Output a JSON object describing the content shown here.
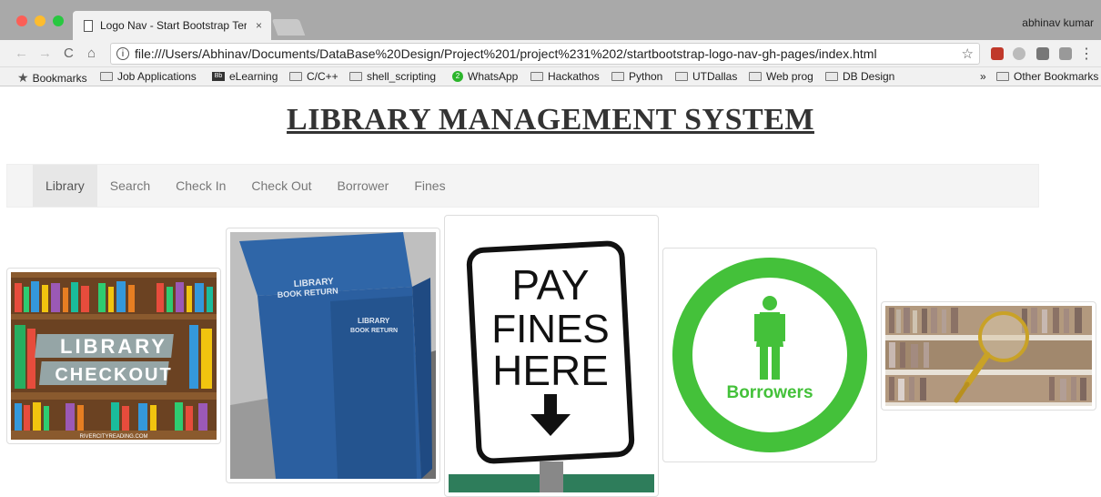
{
  "window": {
    "tab_title": "Logo Nav - Start Bootstrap Ter",
    "tab_close": "×",
    "user": "abhinav kumar",
    "url": "file:///Users/Abhinav/Documents/DataBase%20Design/Project%201/project%231%202/startbootstrap-logo-nav-gh-pages/index.html",
    "info_glyph": "i"
  },
  "nav_glyphs": {
    "back": "←",
    "forward": "→",
    "reload": "C",
    "home": "⌂",
    "star": "☆",
    "menu": "⋮"
  },
  "bookmarks": {
    "star_glyph": "★",
    "items": [
      {
        "label": "Bookmarks",
        "icon": "star-icon"
      },
      {
        "label": "Job Applications",
        "icon": "folder-icon"
      },
      {
        "label": "eLearning",
        "icon": "elearning-icon",
        "badge": "Bb"
      },
      {
        "label": "C/C++",
        "icon": "folder-icon"
      },
      {
        "label": "shell_scripting",
        "icon": "folder-icon"
      },
      {
        "label": "WhatsApp",
        "icon": "whatsapp-icon",
        "badge": "2"
      },
      {
        "label": "Hackathos",
        "icon": "folder-icon"
      },
      {
        "label": "Python",
        "icon": "folder-icon"
      },
      {
        "label": "UTDallas",
        "icon": "folder-icon"
      },
      {
        "label": "Web prog",
        "icon": "folder-icon"
      },
      {
        "label": "DB Design",
        "icon": "folder-icon"
      }
    ],
    "overflow": "»",
    "other": "Other Bookmarks"
  },
  "page": {
    "title": "LIBRARY MANAGEMENT SYSTEM",
    "nav": [
      "Library",
      "Search",
      "Check In",
      "Check Out",
      "Borrower",
      "Fines"
    ],
    "active_nav": "Library"
  },
  "images": {
    "checkout": {
      "line1": "LIBRARY",
      "line2": "CHECKOUT",
      "footer": "RIVERCITYREADING.COM"
    },
    "dropbox": {
      "label1": "LIBRARY",
      "label2": "BOOK RETURN"
    },
    "fines": {
      "line1": "PAY",
      "line2": "FINES",
      "line3": "HERE"
    },
    "borrowers": {
      "label": "Borrowers"
    }
  },
  "colors": {
    "brand_green": "#44c13a",
    "dropbox_blue": "#2b5fa0",
    "navbar_bg": "#f4f4f4"
  }
}
